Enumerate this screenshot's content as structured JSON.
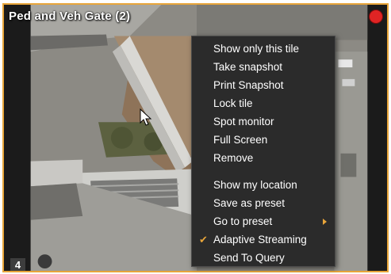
{
  "tile": {
    "title": "Ped and Veh Gate (2)",
    "number": "4",
    "border_color": "#e8a53a",
    "status_color": "#e02424"
  },
  "context_menu": {
    "group1": [
      {
        "label": "Show only this tile"
      },
      {
        "label": "Take snapshot"
      },
      {
        "label": "Print Snapshot"
      },
      {
        "label": "Lock tile"
      },
      {
        "label": "Spot monitor"
      },
      {
        "label": "Full Screen"
      },
      {
        "label": "Remove"
      }
    ],
    "group2": [
      {
        "label": "Show my location"
      },
      {
        "label": "Save as preset"
      },
      {
        "label": "Go to preset",
        "has_submenu": true
      },
      {
        "label": "Adaptive Streaming",
        "checked": true
      },
      {
        "label": "Send To Query"
      }
    ],
    "check_glyph": "✔",
    "accent_color": "#e8a53a"
  }
}
